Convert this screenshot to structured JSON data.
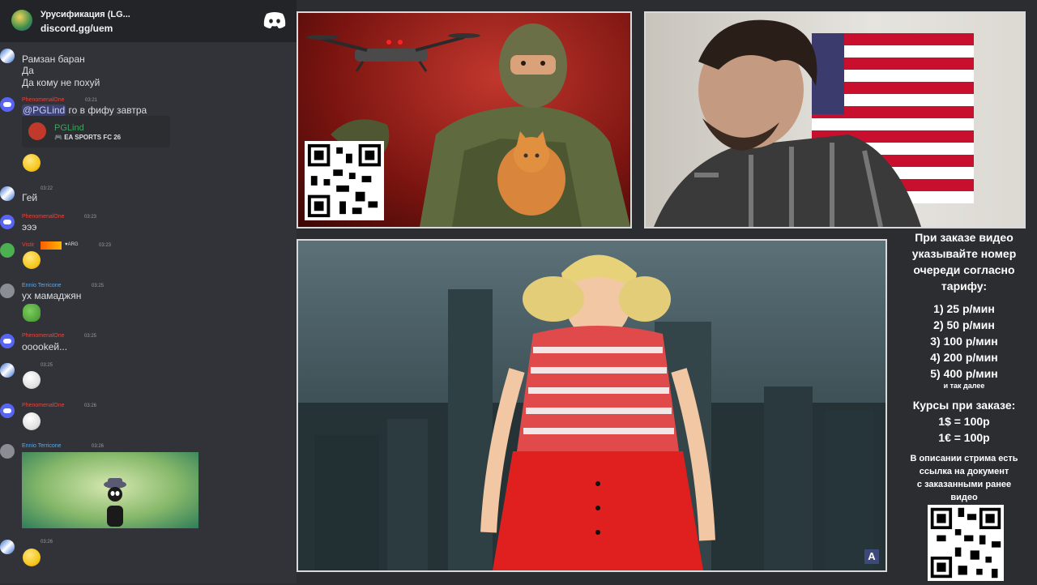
{
  "discord": {
    "server_name": "Урусификация (LG...",
    "invite": "discord.gg/uem",
    "messages": [
      {
        "lines": [
          "Рамзан баран",
          "Да",
          "Да кому не похуй"
        ]
      },
      {
        "username": "PhenomenalOne",
        "time": "03:21",
        "mention": "@PGLind",
        "text": " го в фифу завтра",
        "embed": {
          "name": "PGLind",
          "game": "EA SPORTS FC 26"
        }
      },
      {
        "time": "03:22",
        "text": "Гей"
      },
      {
        "username": "PhenomenalOne",
        "time": "03:23",
        "text": "эээ"
      },
      {
        "username": "Vistir",
        "time": "03:23",
        "badge": "ARG"
      },
      {
        "username": "Ennio Terricone",
        "time": "03:25",
        "text": "ух мамаджян"
      },
      {
        "username": "PhenomenalOne",
        "time": "03:25",
        "text": "ооookей..."
      },
      {
        "time": "03:25"
      },
      {
        "username": "PhenomenalOne",
        "time": "03:26"
      },
      {
        "username": "Ennio Terricone",
        "time": "03:26"
      },
      {
        "time": "03:26"
      }
    ]
  },
  "pricing": {
    "intro": [
      "При заказе видео",
      "указывайте номер",
      "очереди согласно",
      "тарифу:"
    ],
    "tiers": [
      "1) 25 р/мин",
      "2) 50 р/мин",
      "3) 100 р/мин",
      "4) 200 р/мин",
      "5) 400 р/мин"
    ],
    "etc": "и так далее",
    "rates_title": "Курсы при заказе:",
    "rates": [
      "1$ = 100р",
      "1€ = 100р"
    ],
    "note": [
      "В описании стрима есть",
      "ссылка на документ",
      "с заказанными ранее",
      "видео"
    ]
  },
  "colors": {
    "chat_bg": "#313338",
    "header_bg": "#232428",
    "username_red": "#e8453c",
    "username_blue": "#5fa8e8",
    "timestamp": "#949ba4",
    "embed_name": "#3ba55d"
  },
  "icons": [
    "discord-logo-icon",
    "qr-code-icon",
    "controller-icon"
  ]
}
